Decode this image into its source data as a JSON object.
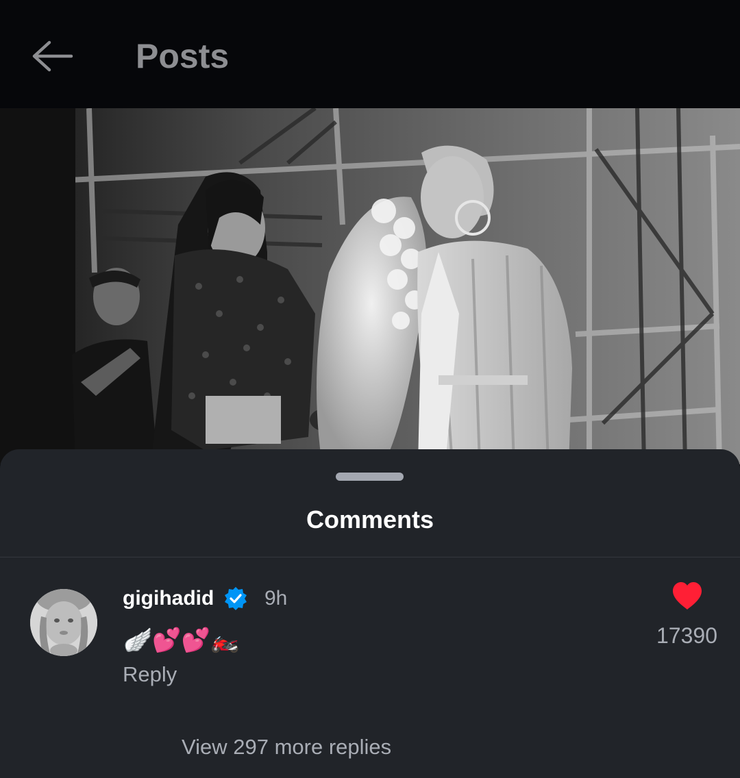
{
  "header": {
    "back_icon": "arrow-left-icon",
    "title": "Posts"
  },
  "post": {
    "image_description_icon": "photo",
    "image_name": "gigi-photo-backstage"
  },
  "comments_sheet": {
    "title": "Comments",
    "comment": {
      "username": "gigihadid",
      "verified_icon": "verified-badge-icon",
      "time": "9h",
      "text_parts": [
        "🪽",
        "💕",
        "💕",
        "🏍️"
      ],
      "reply_label": "Reply",
      "like_icon": "heart-icon",
      "like_count": "17390",
      "view_replies_label": "View 297 more replies"
    }
  },
  "colors": {
    "background": "#060709",
    "sheet": "#212429",
    "accent_heart": "#ff1f35",
    "verified_blue": "#0095f6",
    "muted_text": "#a9adb5"
  }
}
